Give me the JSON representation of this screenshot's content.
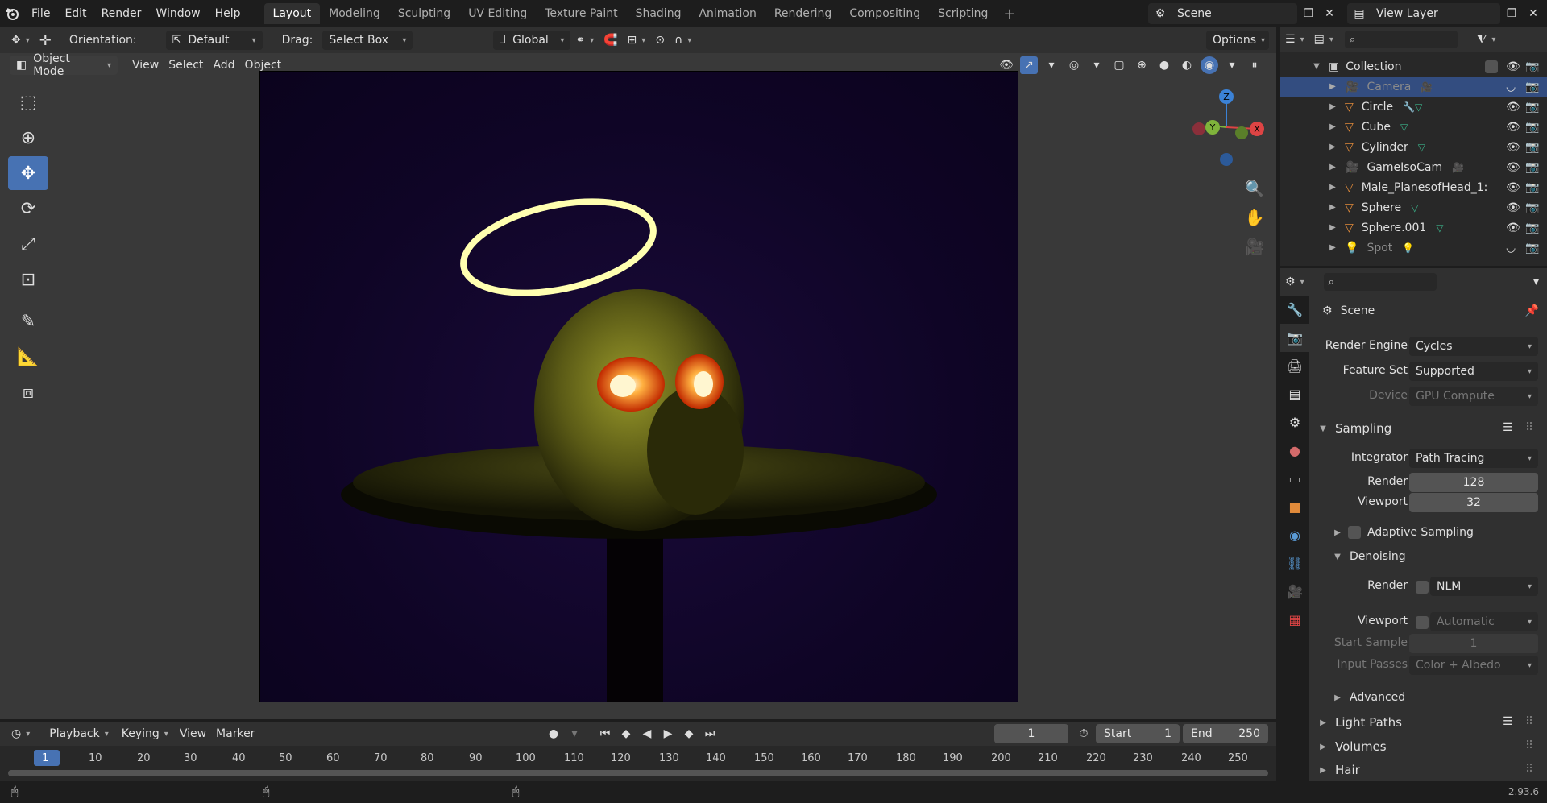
{
  "menu": [
    "File",
    "Edit",
    "Render",
    "Window",
    "Help"
  ],
  "workspaces": [
    "Layout",
    "Modeling",
    "Sculpting",
    "UV Editing",
    "Texture Paint",
    "Shading",
    "Animation",
    "Rendering",
    "Compositing",
    "Scripting"
  ],
  "active_workspace": "Layout",
  "scene": "Scene",
  "view_layer": "View Layer",
  "toolbar": {
    "orientation_label": "Orientation:",
    "orientation_value": "Default",
    "drag_label": "Drag:",
    "drag_value": "Select Box",
    "transform_value": "Global",
    "options_label": "Options"
  },
  "viewport_header": {
    "mode": "Object Mode",
    "view": "View",
    "select": "Select",
    "add": "Add",
    "object": "Object"
  },
  "gizmo": {
    "z": "Z",
    "y": "Y",
    "x": "X"
  },
  "outliner": {
    "collection": "Collection",
    "items": [
      {
        "name": "Camera",
        "selected": true
      },
      {
        "name": "Circle"
      },
      {
        "name": "Cube"
      },
      {
        "name": "Cylinder"
      },
      {
        "name": "GameIsoCam"
      },
      {
        "name": "Male_PlanesofHead_1:"
      },
      {
        "name": "Sphere"
      },
      {
        "name": "Sphere.001"
      },
      {
        "name": "Spot"
      }
    ]
  },
  "properties": {
    "context": "Scene",
    "render_engine_label": "Render Engine",
    "render_engine": "Cycles",
    "feature_set_label": "Feature Set",
    "feature_set": "Supported",
    "device_label": "Device",
    "device": "GPU Compute",
    "sampling": "Sampling",
    "integrator_label": "Integrator",
    "integrator": "Path Tracing",
    "render_label": "Render",
    "render_samples": "128",
    "viewport_label": "Viewport",
    "viewport_samples": "32",
    "adaptive_sampling": "Adaptive Sampling",
    "denoising": "Denoising",
    "denoise_render_label": "Render",
    "denoise_render": "NLM",
    "denoise_viewport_label": "Viewport",
    "denoise_viewport": "Automatic",
    "start_sample_label": "Start Sample",
    "start_sample": "1",
    "input_passes_label": "Input Passes",
    "input_passes": "Color + Albedo",
    "advanced": "Advanced",
    "light_paths": "Light Paths",
    "volumes": "Volumes",
    "hair": "Hair"
  },
  "timeline": {
    "playback": "Playback",
    "keying": "Keying",
    "view": "View",
    "marker": "Marker",
    "current_frame": "1",
    "start_label": "Start",
    "start": "1",
    "end_label": "End",
    "end": "250",
    "ticks": [
      "1",
      "10",
      "20",
      "30",
      "40",
      "50",
      "60",
      "70",
      "80",
      "90",
      "100",
      "110",
      "120",
      "130",
      "140",
      "150",
      "160",
      "170",
      "180",
      "190",
      "200",
      "210",
      "220",
      "230",
      "240",
      "250"
    ]
  },
  "version": "2.93.6"
}
